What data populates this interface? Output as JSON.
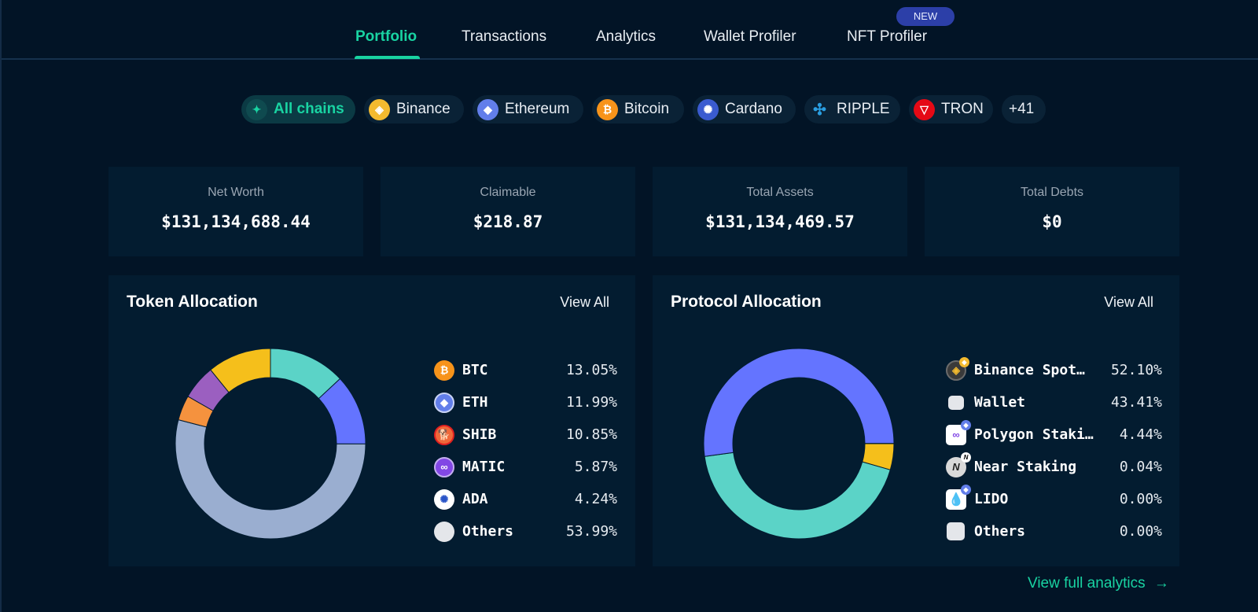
{
  "nav": {
    "tabs": [
      {
        "label": "Portfolio",
        "active": true
      },
      {
        "label": "Transactions",
        "active": false
      },
      {
        "label": "Analytics",
        "active": false
      },
      {
        "label": "Wallet Profiler",
        "active": false
      },
      {
        "label": "NFT Profiler",
        "active": false
      }
    ],
    "new_badge": "NEW"
  },
  "chains": {
    "items": [
      {
        "label": "All chains",
        "icon": "all-chains-icon",
        "active": true
      },
      {
        "label": "Binance",
        "icon": "binance-icon"
      },
      {
        "label": "Ethereum",
        "icon": "ethereum-icon"
      },
      {
        "label": "Bitcoin",
        "icon": "bitcoin-icon"
      },
      {
        "label": "Cardano",
        "icon": "cardano-icon"
      },
      {
        "label": "RIPPLE",
        "icon": "ripple-icon"
      },
      {
        "label": "TRON",
        "icon": "tron-icon"
      }
    ],
    "more_label": "+41"
  },
  "stats": [
    {
      "label": "Net Worth",
      "value": "$131,134,688.44"
    },
    {
      "label": "Claimable",
      "value": "$218.87"
    },
    {
      "label": "Total Assets",
      "value": "$131,134,469.57"
    },
    {
      "label": "Total Debts",
      "value": "$0"
    }
  ],
  "token_allocation": {
    "title": "Token Allocation",
    "view_all": "View All",
    "items": [
      {
        "name": "BTC",
        "percent": "13.05%",
        "icon": "bitcoin-icon"
      },
      {
        "name": "ETH",
        "percent": "11.99%",
        "icon": "ethereum-icon"
      },
      {
        "name": "SHIB",
        "percent": "10.85%",
        "icon": "shiba-icon"
      },
      {
        "name": "MATIC",
        "percent": "5.87%",
        "icon": "polygon-icon"
      },
      {
        "name": "ADA",
        "percent": "4.24%",
        "icon": "cardano-icon"
      },
      {
        "name": "Others",
        "percent": "53.99%",
        "icon": "others-icon"
      }
    ]
  },
  "protocol_allocation": {
    "title": "Protocol Allocation",
    "view_all": "View All",
    "items": [
      {
        "name": "Binance Spot…",
        "percent": "52.10%",
        "icon": "binance-spot-icon"
      },
      {
        "name": "Wallet",
        "percent": "43.41%",
        "icon": "wallet-icon"
      },
      {
        "name": "Polygon Staki…",
        "percent": "4.44%",
        "icon": "polygon-staking-icon"
      },
      {
        "name": "Near Staking",
        "percent": "0.04%",
        "icon": "near-staking-icon"
      },
      {
        "name": "LIDO",
        "percent": "0.00%",
        "icon": "lido-icon"
      },
      {
        "name": "Others",
        "percent": "0.00%",
        "icon": "others-icon"
      }
    ]
  },
  "footer": {
    "view_full_analytics": "View full analytics"
  },
  "chart_data": [
    {
      "type": "pie",
      "title": "Token Allocation",
      "donut": true,
      "categories": [
        "BTC",
        "ETH",
        "Others",
        "ADA",
        "MATIC",
        "SHIB"
      ],
      "values": [
        13.05,
        11.99,
        53.99,
        4.24,
        5.87,
        10.85
      ],
      "colors": [
        "#5bd3c7",
        "#6474ff",
        "#9aaed0",
        "#f5923e",
        "#9b5fc0",
        "#f5bf1b"
      ],
      "start": "12 o'clock, clockwise"
    },
    {
      "type": "pie",
      "title": "Protocol Allocation",
      "donut": true,
      "categories": [
        "Polygon Staking",
        "Wallet",
        "Binance Spot",
        "Near Staking",
        "LIDO",
        "Others"
      ],
      "values": [
        4.44,
        43.41,
        52.1,
        0.04,
        0.0,
        0.0
      ],
      "colors": [
        "#f5bf1b",
        "#5bd3c7",
        "#6474ff",
        "#9b5fc0",
        "#f5923e",
        "#9aaed0"
      ],
      "start": "3 o'clock, clockwise"
    }
  ]
}
